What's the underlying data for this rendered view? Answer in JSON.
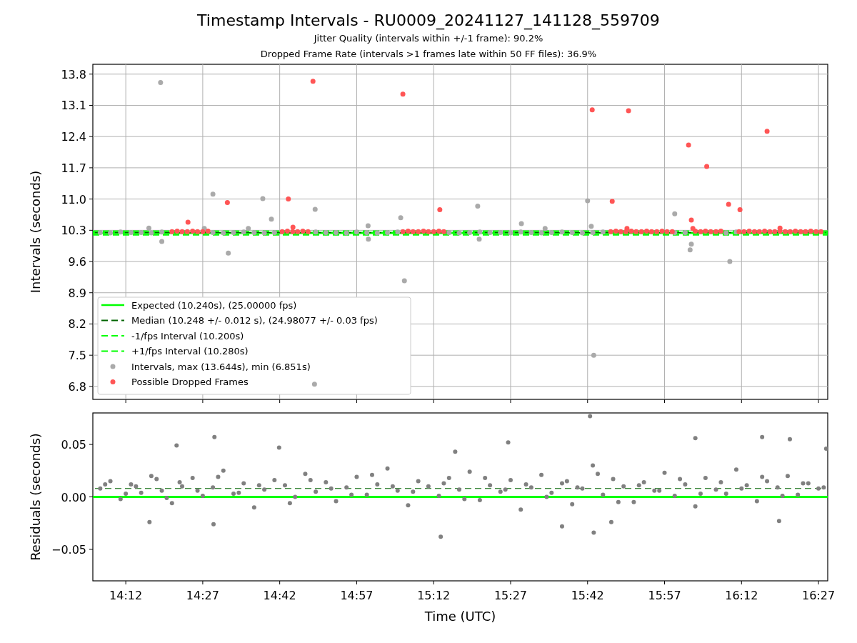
{
  "figure": {
    "title": "Timestamp Intervals - RU0009_20241127_141128_559709",
    "subtitles": [
      "Jitter Quality (intervals within +/-1 frame): 90.2%",
      "Dropped Frame Rate (intervals >1 frames late within 50 FF files): 36.9%"
    ]
  },
  "panels": [
    {
      "chart_data": {
        "type": "scatter",
        "ylabel": "Intervals (seconds)",
        "grid": true,
        "legend": true,
        "xlim": [
          14.093,
          16.48
        ],
        "ylim": [
          6.51,
          14.02
        ],
        "yticks": [
          {
            "value": 6.8,
            "label": "6.8"
          },
          {
            "value": 7.5,
            "label": "7.5"
          },
          {
            "value": 8.2,
            "label": "8.2"
          },
          {
            "value": 8.9,
            "label": "8.9"
          },
          {
            "value": 9.6,
            "label": "9.6"
          },
          {
            "value": 10.3,
            "label": "10.3"
          },
          {
            "value": 11.0,
            "label": "11.0"
          },
          {
            "value": 11.7,
            "label": "11.7"
          },
          {
            "value": 12.4,
            "label": "12.4"
          },
          {
            "value": 13.1,
            "label": "13.1"
          },
          {
            "value": 13.8,
            "label": "13.8"
          }
        ],
        "ref_lines": [
          {
            "axis": "y",
            "value": 10.24,
            "label": "Expected (10.240s), (25.00000 fps)",
            "color": "#00ff00"
          },
          {
            "axis": "y",
            "value": 10.248,
            "label": "Median (10.248 +/- 0.012 s), (24.98077 +/- 0.03 fps)",
            "color": "#006400"
          },
          {
            "axis": "y",
            "value": 10.2,
            "label": "-1/fps Interval (10.200s)",
            "color": "#00ff00"
          },
          {
            "axis": "y",
            "value": 10.28,
            "label": "+1/fps Interval (10.280s)",
            "color": "#00ff00"
          }
        ],
        "series": [
          {
            "name": "Intervals, max (13.644s), min (6.851s)",
            "color": "#aaaaaa",
            "x": [
              14.117,
              14.15,
              14.183,
              14.217,
              14.25,
              14.283,
              14.317,
              14.483,
              14.517,
              14.55,
              14.583,
              14.617,
              14.65,
              14.683,
              14.817,
              14.85,
              14.883,
              14.917,
              14.95,
              14.983,
              15.017,
              15.05,
              15.083,
              15.25,
              15.283,
              15.317,
              15.35,
              15.383,
              15.417,
              15.45,
              15.483,
              15.517,
              15.55,
              15.583,
              15.617,
              15.65,
              15.683,
              15.717,
              15.75,
              15.983,
              16.017,
              16.15,
              16.183,
              14.313,
              14.317,
              14.275,
              14.483,
              14.533,
              14.645,
              14.673,
              14.598,
              14.815,
              14.813,
              14.987,
              14.988,
              15.093,
              15.105,
              15.343,
              15.348,
              15.485,
              15.562,
              15.7,
              15.712,
              15.72,
              15.983,
              16.033,
              16.037,
              16.162,
              14.455
            ],
            "values": [
              10.25,
              10.24,
              10.26,
              10.25,
              10.25,
              10.24,
              10.26,
              10.25,
              10.24,
              10.25,
              10.26,
              10.25,
              10.24,
              10.25,
              10.26,
              10.25,
              10.25,
              10.24,
              10.26,
              10.25,
              10.24,
              10.25,
              10.26,
              10.25,
              10.24,
              10.25,
              10.26,
              10.25,
              10.25,
              10.24,
              10.26,
              10.25,
              10.24,
              10.25,
              10.26,
              10.25,
              10.24,
              10.25,
              10.26,
              10.25,
              10.25,
              10.24,
              10.26,
              13.61,
              10.05,
              10.35,
              11.11,
              9.79,
              11.01,
              10.55,
              10.34,
              10.77,
              6.85,
              10.4,
              10.1,
              10.58,
              9.17,
              10.84,
              10.1,
              10.45,
              10.34,
              10.96,
              10.39,
              7.5,
              10.67,
              9.86,
              9.99,
              9.6,
              10.34
            ]
          },
          {
            "name": "Possible Dropped Frames",
            "color": "#ff5555",
            "x": [
              14.35,
              14.367,
              14.383,
              14.4,
              14.417,
              14.433,
              14.45,
              14.467,
              14.708,
              14.725,
              14.742,
              14.758,
              14.775,
              14.792,
              15.1,
              15.117,
              15.133,
              15.15,
              15.167,
              15.183,
              15.2,
              15.217,
              15.233,
              15.775,
              15.792,
              15.808,
              15.825,
              15.842,
              15.858,
              15.875,
              15.892,
              15.908,
              15.925,
              15.942,
              15.958,
              15.975,
              16.05,
              16.067,
              16.083,
              16.1,
              16.117,
              16.133,
              16.192,
              16.208,
              16.225,
              16.242,
              16.258,
              16.275,
              16.292,
              16.308,
              16.325,
              16.342,
              16.358,
              16.375,
              16.392,
              16.408,
              16.425,
              16.442,
              16.458,
              14.808,
              15.1,
              14.53,
              14.402,
              14.728,
              14.743,
              15.22,
              15.715,
              15.833,
              15.78,
              16.028,
              16.087,
              16.283,
              16.158,
              16.195,
              16.037,
              16.042,
              15.828,
              16.325
            ],
            "values": [
              10.27,
              10.28,
              10.27,
              10.27,
              10.28,
              10.27,
              10.27,
              10.28,
              10.27,
              10.28,
              10.27,
              10.27,
              10.28,
              10.27,
              10.27,
              10.28,
              10.27,
              10.27,
              10.28,
              10.27,
              10.27,
              10.28,
              10.27,
              10.27,
              10.28,
              10.27,
              10.27,
              10.28,
              10.27,
              10.27,
              10.28,
              10.27,
              10.27,
              10.28,
              10.27,
              10.27,
              10.28,
              10.27,
              10.28,
              10.27,
              10.27,
              10.28,
              10.27,
              10.27,
              10.28,
              10.27,
              10.27,
              10.28,
              10.27,
              10.27,
              10.28,
              10.27,
              10.27,
              10.28,
              10.27,
              10.27,
              10.28,
              10.27,
              10.27,
              13.64,
              13.35,
              10.92,
              10.48,
              11.0,
              10.37,
              10.76,
              13.0,
              12.98,
              10.95,
              12.21,
              11.73,
              12.52,
              10.88,
              10.76,
              10.53,
              10.34,
              10.34,
              10.35
            ]
          }
        ]
      }
    },
    {
      "chart_data": {
        "type": "scatter",
        "xlabel": "Time (UTC)",
        "ylabel": "Residuals (seconds)",
        "xlim": [
          14.093,
          16.48
        ],
        "ylim": [
          -0.08,
          0.08
        ],
        "xticks": [
          {
            "value": 14.2,
            "label": "14:12"
          },
          {
            "value": 14.45,
            "label": "14:27"
          },
          {
            "value": 14.7,
            "label": "14:42"
          },
          {
            "value": 14.95,
            "label": "14:57"
          },
          {
            "value": 15.2,
            "label": "15:12"
          },
          {
            "value": 15.45,
            "label": "15:27"
          },
          {
            "value": 15.7,
            "label": "15:42"
          },
          {
            "value": 15.95,
            "label": "15:57"
          },
          {
            "value": 16.2,
            "label": "16:12"
          },
          {
            "value": 16.45,
            "label": "16:27"
          }
        ],
        "yticks": [
          {
            "value": -0.05,
            "label": "−0.05"
          },
          {
            "value": 0,
            "label": "0.00"
          },
          {
            "value": 0.05,
            "label": "0.05"
          }
        ],
        "ref_lines": [
          {
            "axis": "y",
            "value": 0,
            "color": "#00ff00"
          },
          {
            "axis": "y",
            "value": 0.008,
            "color": "#006400"
          }
        ],
        "series": [
          {
            "color": "#808080",
            "x": [
              14.117,
              14.15,
              14.183,
              14.217,
              14.25,
              14.283,
              14.317,
              14.35,
              14.383,
              14.417,
              14.45,
              14.483,
              14.517,
              14.55,
              14.583,
              14.617,
              14.65,
              14.683,
              14.717,
              14.75,
              14.783,
              14.817,
              14.85,
              14.883,
              14.917,
              14.95,
              14.983,
              15.017,
              15.05,
              15.083,
              15.117,
              15.15,
              15.183,
              15.217,
              15.25,
              15.283,
              15.317,
              15.35,
              15.383,
              15.417,
              15.45,
              15.483,
              15.517,
              15.55,
              15.583,
              15.617,
              15.65,
              15.683,
              15.717,
              15.75,
              15.783,
              15.817,
              15.85,
              15.883,
              15.917,
              15.95,
              15.983,
              16.017,
              16.05,
              16.083,
              16.117,
              16.15,
              16.183,
              16.217,
              16.25,
              16.283,
              16.317,
              16.35,
              16.383,
              16.417,
              16.45,
              14.133,
              14.2,
              14.233,
              14.3,
              14.333,
              14.375,
              14.433,
              14.5,
              14.567,
              14.633,
              14.733,
              14.8,
              14.867,
              14.933,
              15.0,
              15.067,
              15.133,
              15.233,
              15.3,
              15.367,
              15.433,
              15.5,
              15.567,
              15.633,
              15.667,
              15.733,
              15.8,
              15.867,
              15.933,
              16.0,
              16.067,
              16.133,
              16.2,
              16.267,
              16.333,
              16.4,
              16.467,
              15.708,
              14.488,
              15.223,
              14.485,
              14.277,
              15.617,
              15.72,
              15.777,
              16.322,
              16.267,
              16.475,
              15.442,
              14.698,
              15.27,
              16.05,
              16.357,
              14.365
            ],
            "values": [
              0.008,
              0.015,
              -0.002,
              0.012,
              0.004,
              0.02,
              0.006,
              -0.006,
              0.01,
              0.018,
              0.001,
              0.009,
              0.025,
              0.003,
              0.013,
              -0.01,
              0.007,
              0.016,
              0.011,
              0.0,
              0.022,
              0.005,
              0.014,
              -0.004,
              0.009,
              0.019,
              0.002,
              0.012,
              0.027,
              0.006,
              -0.008,
              0.015,
              0.01,
              0.001,
              0.018,
              0.007,
              0.024,
              -0.003,
              0.011,
              0.005,
              0.016,
              -0.012,
              0.009,
              0.021,
              0.004,
              0.013,
              -0.007,
              0.008,
              0.03,
              0.002,
              0.017,
              0.01,
              -0.005,
              0.014,
              0.006,
              0.023,
              0.001,
              0.012,
              -0.009,
              0.018,
              0.007,
              0.003,
              0.026,
              0.011,
              -0.004,
              0.015,
              0.009,
              0.02,
              0.002,
              0.013,
              0.008,
              0.012,
              0.003,
              0.01,
              0.017,
              -0.001,
              0.014,
              0.006,
              0.019,
              0.004,
              0.011,
              -0.006,
              0.016,
              0.008,
              0.002,
              0.021,
              0.01,
              0.005,
              0.013,
              -0.002,
              0.018,
              0.007,
              0.012,
              0.0,
              0.015,
              0.009,
              0.022,
              -0.005,
              0.011,
              0.006,
              0.017,
              0.003,
              0.014,
              0.008,
              0.019,
              0.001,
              0.013,
              0.009,
              0.077,
              0.057,
              -0.038,
              -0.026,
              -0.024,
              -0.028,
              -0.034,
              -0.024,
              -0.023,
              0.057,
              0.046,
              0.052,
              0.047,
              0.043,
              0.056,
              0.055,
              0.049
            ]
          }
        ]
      }
    }
  ]
}
